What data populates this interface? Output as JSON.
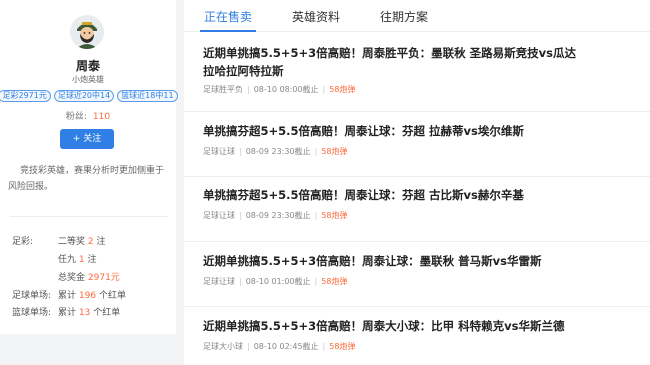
{
  "profile": {
    "name": "周泰",
    "title": "小炮英雄",
    "badges": [
      "足彩2971元",
      "足球近20中14",
      "篮球近18中11"
    ],
    "fans_label": "粉丝:",
    "fans_count": "110",
    "follow_label": "+ 关注",
    "description": "竞技彩英雄，赛果分析时更加侧重于风险回报。",
    "stats": {
      "zucai_label": "足彩:",
      "prize2_text": "二等奖",
      "prize2_count": "2",
      "prize2_unit": "注",
      "ren9_text": "任九",
      "ren9_count": "1",
      "ren9_unit": "注",
      "total_text": "总奖金",
      "total_value": "2971元",
      "football_label": "足球单场:",
      "football_pre": "累计",
      "football_count": "196",
      "football_post": "个红单",
      "basketball_label": "篮球单场:",
      "basketball_pre": "累计",
      "basketball_count": "13",
      "basketball_post": "个红单"
    }
  },
  "tabs": [
    "正在售卖",
    "英雄资料",
    "往期方案"
  ],
  "articles": [
    {
      "title": "近期单挑搞5.5+5+3倍高赔！周泰胜平负：墨联秋 圣路易斯竞技vs瓜达拉哈拉阿特拉斯",
      "category": "足球胜平负",
      "time": "08-10 08:00截止",
      "price": "58炮弹"
    },
    {
      "title": "单挑搞芬超5+5.5倍高赔！周泰让球：芬超 拉赫蒂vs埃尔维斯",
      "category": "足球让球",
      "time": "08-09 23:30截止",
      "price": "58炮弹"
    },
    {
      "title": "单挑搞芬超5+5.5倍高赔！周泰让球：芬超 古比斯vs赫尔辛基",
      "category": "足球让球",
      "time": "08-09 23:30截止",
      "price": "58炮弹"
    },
    {
      "title": "近期单挑搞5.5+5+3倍高赔！周泰让球：墨联秋 普马斯vs华雷斯",
      "category": "足球让球",
      "time": "08-10 01:00截止",
      "price": "58炮弹"
    },
    {
      "title": "近期单挑搞5.5+5+3倍高赔！周泰大小球：比甲 科特赖克vs华斯兰德",
      "category": "足球大小球",
      "time": "08-10 02:45截止",
      "price": "58炮弹"
    }
  ]
}
